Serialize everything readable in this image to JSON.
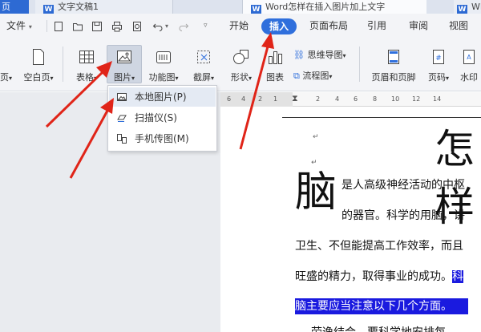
{
  "tabs": {
    "home": "页",
    "doc_title": "文字文稿1",
    "web_title": "Word怎样在插入图片加上文字",
    "wps": "WP"
  },
  "menu": {
    "file": "文件",
    "start": "开始",
    "insert": "插入",
    "page_layout": "页面布局",
    "reference": "引用",
    "review": "审阅",
    "view": "视图"
  },
  "ribbon": {
    "page_frag": "页",
    "blank_page": "空白页",
    "table": "表格",
    "picture": "图片",
    "function_chart": "功能图",
    "screenshot": "截屏",
    "shape": "形状",
    "chart": "图表",
    "mindmap": "思维导图",
    "flowchart": "流程图",
    "header_footer": "页眉和页脚",
    "page_number": "页码",
    "watermark": "水印"
  },
  "dropdown": {
    "items": [
      "本地图片(P)",
      "扫描仪(S)",
      "手机传图(M)"
    ]
  },
  "ruler": {
    "ticks": [
      "6",
      "4",
      "2",
      "1",
      "2",
      "4",
      "6",
      "8",
      "10",
      "12",
      "14"
    ]
  },
  "document": {
    "title_char": "怎样",
    "dropcap": "脑",
    "line1": "是人高级神经活动的中枢",
    "line2": "的器官。科学的用脑，讲",
    "line3": "卫生、不但能提高工作效率，而且",
    "line4_plain": "旺盛的精力，取得事业的成功。",
    "line4_sel": "科",
    "line5_sel": "脑主要应当注意以下几个方面。",
    "line6": "劳逸结合，要科学地安排每"
  }
}
